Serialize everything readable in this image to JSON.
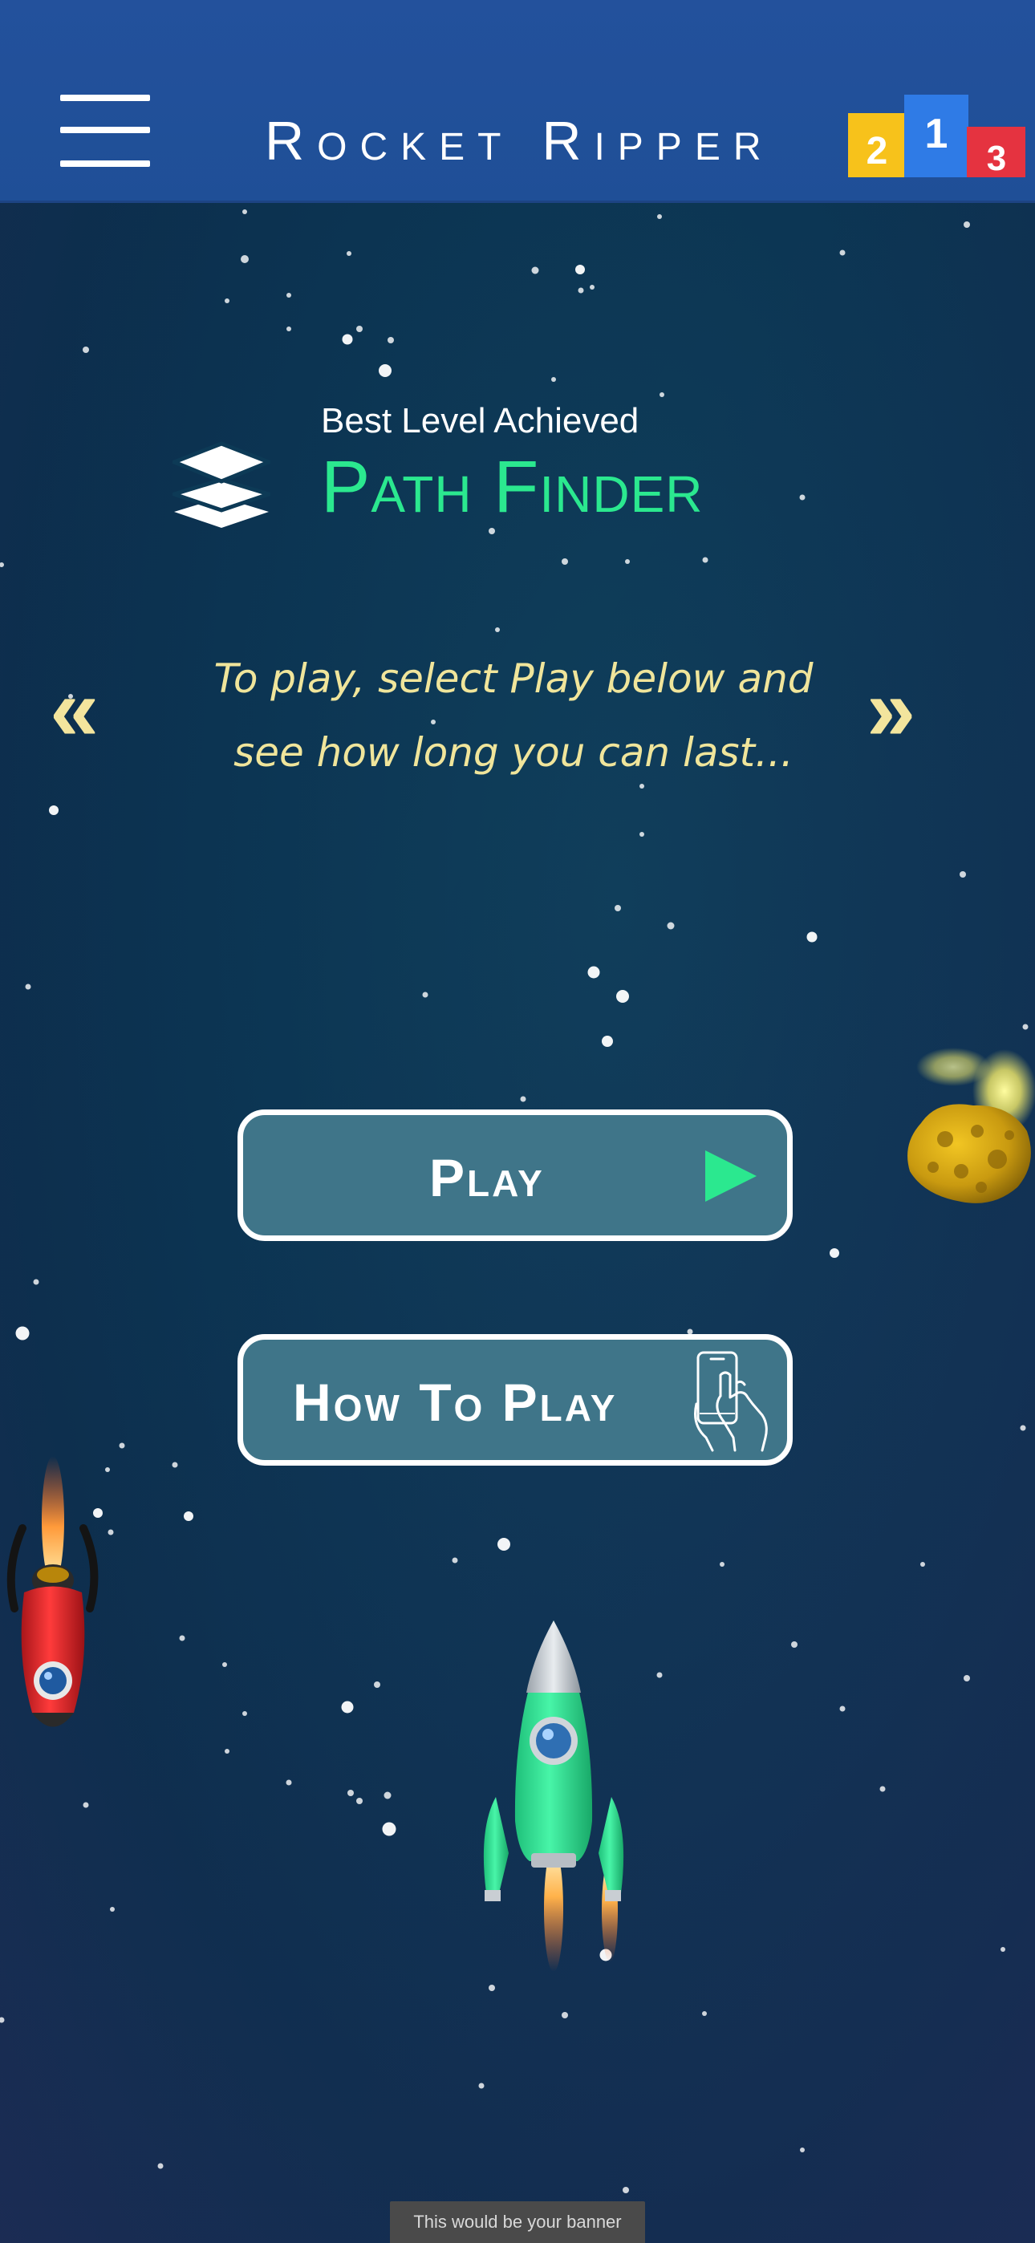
{
  "header": {
    "title": "Rocket Ripper",
    "menu_icon": "hamburger-menu-icon",
    "leaderboard_icon": "podium-leaderboard-icon",
    "leaderboard_ranks": [
      "2",
      "1",
      "3"
    ]
  },
  "best_level": {
    "caption": "Best Level Achieved",
    "name": "Path Finder",
    "icon": "layers-icon"
  },
  "tip": {
    "prev_arrow": "«",
    "next_arrow": "»",
    "text": "To play, select Play below and see how long you can last..."
  },
  "buttons": {
    "play_label": "Play",
    "play_icon": "play-triangle-icon",
    "how_to_play_label": "How To Play",
    "how_to_play_icon": "phone-touch-icon"
  },
  "banner": {
    "text": "This would be your banner"
  },
  "colors": {
    "header_bg": "#23519c",
    "level_name": "#2be88f",
    "tip_text": "#f0e59b",
    "button_bg": "#3f7589",
    "play_icon": "#2be88f",
    "podium_gold": "#f7c21b",
    "podium_blue": "#2f7be6",
    "podium_red": "#e53340"
  }
}
